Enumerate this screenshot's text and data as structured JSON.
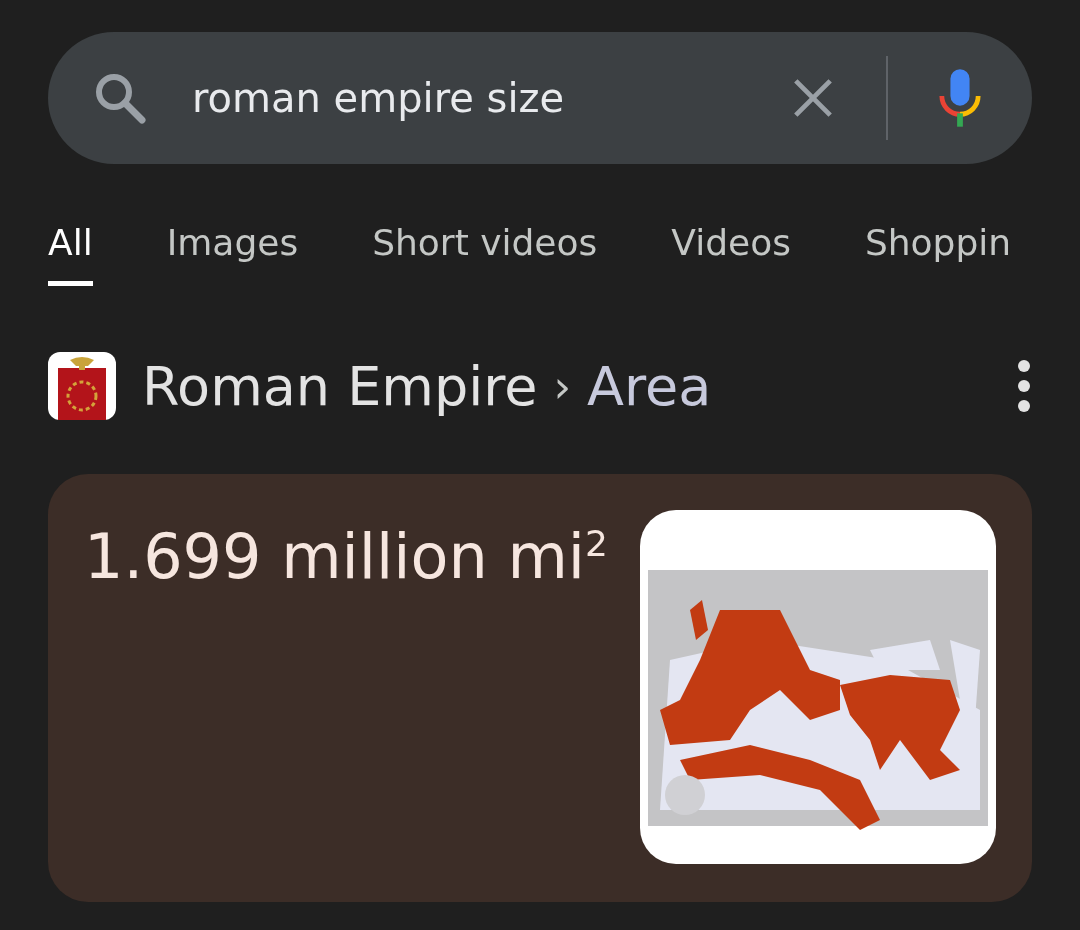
{
  "search": {
    "value": "roman empire size"
  },
  "tabs": [
    {
      "label": "All",
      "selected": true
    },
    {
      "label": "Images",
      "selected": false
    },
    {
      "label": "Short videos",
      "selected": false
    },
    {
      "label": "Videos",
      "selected": false
    },
    {
      "label": "Shoppin",
      "selected": false
    }
  ],
  "result": {
    "title": "Roman Empire",
    "separator": "›",
    "subtitle": "Area",
    "answer": {
      "value": "1.699 million mi$^{2}$"
    }
  }
}
